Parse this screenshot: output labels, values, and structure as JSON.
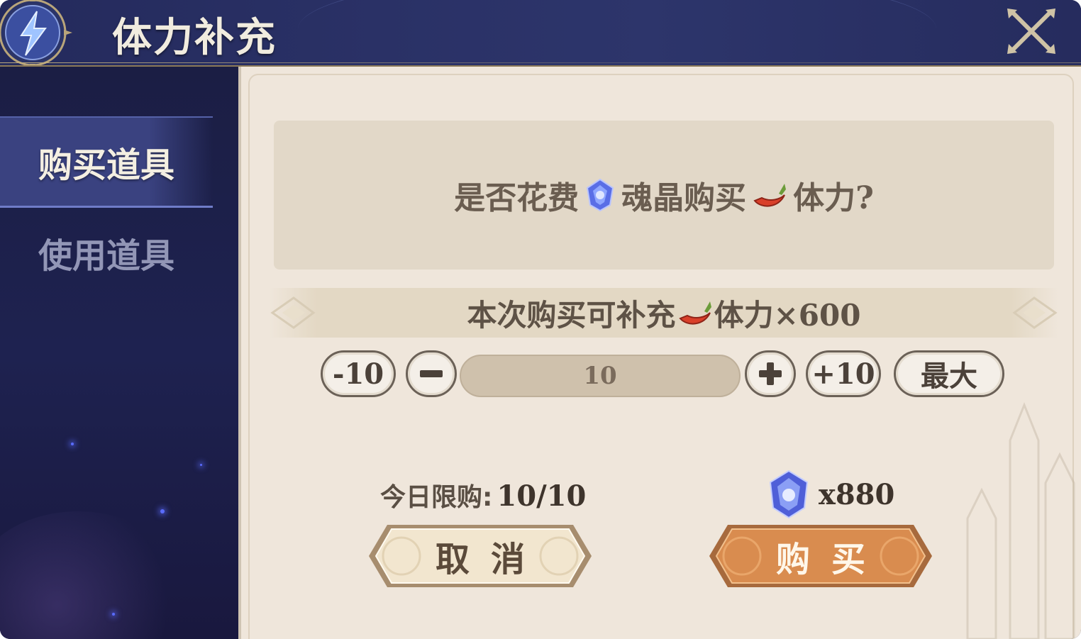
{
  "header": {
    "title": "体力补充"
  },
  "sidebar": {
    "items": [
      {
        "label": "购买道具",
        "active": true
      },
      {
        "label": "使用道具",
        "active": false
      }
    ]
  },
  "prompt": {
    "part1": "是否花费",
    "part2": "魂晶购买",
    "part3": "体力?"
  },
  "ribbon": {
    "prefix": "本次购买可补充",
    "suffix": "体力×600"
  },
  "quantity": {
    "minus10_label": "-10",
    "plus10_label": "+10",
    "max_label": "最大",
    "value": "10"
  },
  "limit": {
    "label": "今日限购:",
    "value": "10/10"
  },
  "cost": {
    "amount": "x880"
  },
  "buttons": {
    "cancel_label": "取消",
    "buy_label": "购买"
  },
  "icons": {
    "crystal": "soul-crystal-icon",
    "stamina": "stamina-chili-icon"
  },
  "colors": {
    "buy_button": "#d98c4f",
    "cancel_button": "#f2e6cf",
    "panel_bg": "#efe6db",
    "sidebar_bg": "#1e2250"
  }
}
